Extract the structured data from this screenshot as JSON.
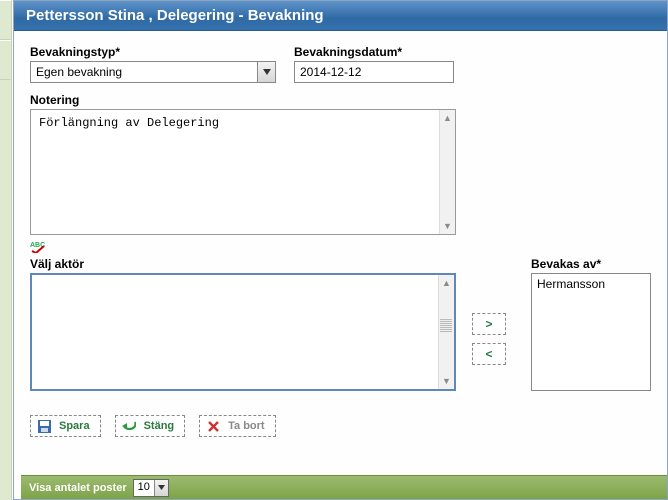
{
  "title": "Pettersson Stina , Delegering - Bevakning",
  "fields": {
    "type_label": "Bevakningstyp*",
    "type_value": "Egen bevakning",
    "date_label": "Bevakningsdatum*",
    "date_value": "2014-12-12",
    "note_label": "Notering",
    "note_value": "Förlängning av Delegering",
    "actor_label": "Välj aktör",
    "watched_label": "Bevakas av*",
    "watched_value": "Hermansson"
  },
  "move": {
    "right": ">",
    "left": "<"
  },
  "buttons": {
    "save": "Spara",
    "close": "Stäng",
    "delete": "Ta bort"
  },
  "footer": {
    "label": "Visa antalet poster",
    "value": "10"
  }
}
